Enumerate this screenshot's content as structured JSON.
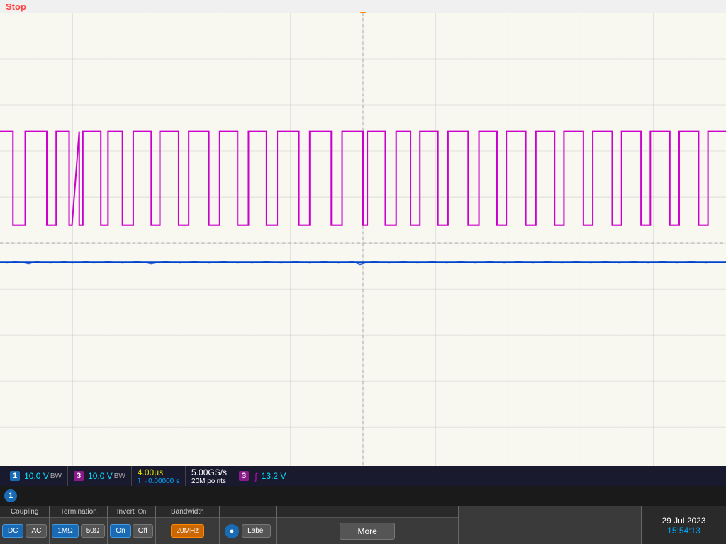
{
  "status": {
    "stop_label": "Stop"
  },
  "measurement_bar": {
    "ch1_badge": "1",
    "ch1_voltage": "10.0 V",
    "ch1_bw": "BW",
    "ch3_badge": "3",
    "ch3_voltage": "10.0 V",
    "ch3_bw": "BW",
    "timebase": "4.00μs",
    "trigger_time": "⊺→0.00000 s",
    "sample_rate": "5.00GS/s",
    "points": "20M points",
    "ch3_meas_badge": "3",
    "ch3_meas_symbol": "∫",
    "ch3_meas_value": "13.2 V"
  },
  "controls": {
    "coupling_label": "Coupling",
    "coupling_dc": "DC",
    "coupling_ac": "AC",
    "termination_label": "Termination",
    "termination_1m": "1MΩ",
    "termination_50": "50Ω",
    "invert_label": "Invert",
    "invert_on": "On",
    "invert_off": "Off",
    "invert_status": "On",
    "bandwidth_label": "Bandwidth",
    "bandwidth_value": "20MHz",
    "label_text": "Label",
    "more_label": "More",
    "channel_num": "1",
    "date": "29 Jul 2023",
    "time": "15:54:13"
  }
}
